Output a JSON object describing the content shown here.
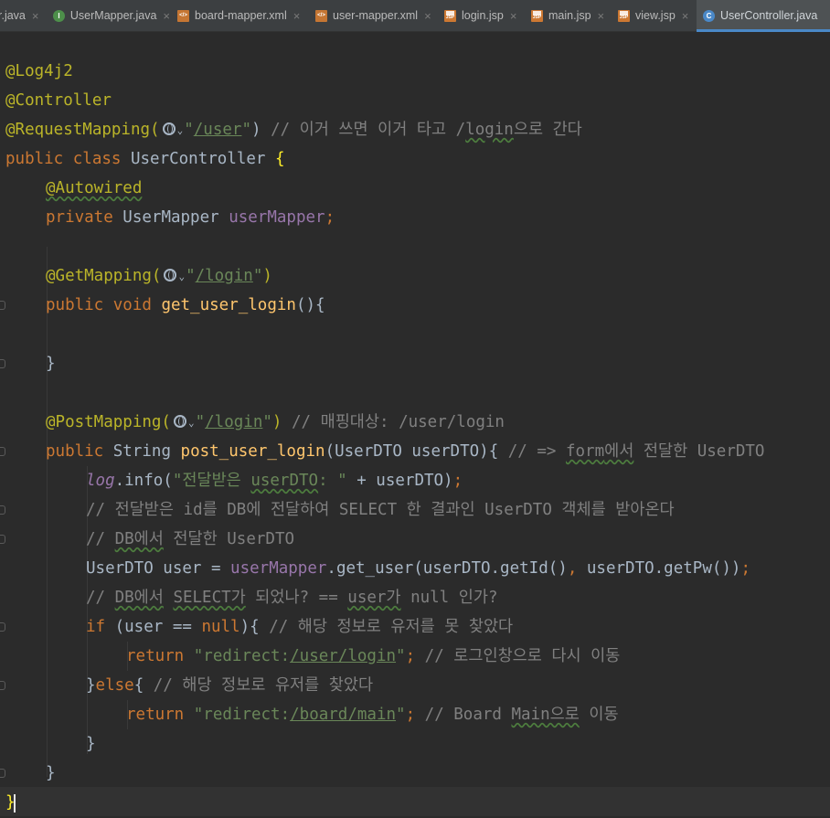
{
  "tabs": [
    {
      "label": "r.java",
      "icon": "java-file-icon",
      "active": false
    },
    {
      "label": "UserMapper.java",
      "icon": "interface-file-icon",
      "active": false
    },
    {
      "label": "board-mapper.xml",
      "icon": "xml-file-icon",
      "active": false
    },
    {
      "label": "user-mapper.xml",
      "icon": "xml-file-icon",
      "active": false
    },
    {
      "label": "login.jsp",
      "icon": "jsp-file-icon",
      "active": false
    },
    {
      "label": "main.jsp",
      "icon": "jsp-file-icon",
      "active": false
    },
    {
      "label": "view.jsp",
      "icon": "jsp-file-icon",
      "active": false
    },
    {
      "label": "UserController.java",
      "icon": "class-file-icon",
      "active": true
    }
  ],
  "tab_close_glyph": "×",
  "icon_glyphs": {
    "java": "I",
    "class": "C",
    "xml": "</>",
    "jsp": "JSP"
  },
  "code": {
    "l1": "@Log4j2",
    "l2": "@Controller",
    "l3": {
      "a": "@RequestMapping(",
      "b": "\"",
      "c": "/user",
      "d": "\"",
      "e": ") ",
      "f": "// 이거 쓰면 이거 타고 /",
      "g": "login",
      "h": "으로 간다"
    },
    "l4": {
      "a": "public class ",
      "b": "UserController ",
      "c": "{"
    },
    "l5": "@Autowired",
    "l6": {
      "a": "private ",
      "b": "UserMapper ",
      "c": "userMapper",
      "d": ";"
    },
    "l7": {
      "a": "@GetMapping(",
      "b": "\"",
      "c": "/login",
      "d": "\"",
      "e": ")"
    },
    "l8": {
      "a": "public void ",
      "b": "get_user_login",
      "c": "(){"
    },
    "l9": "}",
    "l10": {
      "a": "@PostMapping(",
      "b": "\"",
      "c": "/login",
      "d": "\"",
      "e": ") ",
      "f": "// 매핑대상: /user/login"
    },
    "l11": {
      "a": "public ",
      "b": "String ",
      "c": "post_user_login",
      "d": "(UserDTO userDTO){ ",
      "e": "// => ",
      "f": "form",
      "g": "에서",
      "h": " 전달한 UserDTO"
    },
    "l12": {
      "a": "log",
      "b": ".info(",
      "c": "\"전달받은 ",
      "d": "userDTO",
      "e": ": \"",
      "f": " + userDTO)",
      "g": ";"
    },
    "l13": "// 전달받은 id를 DB에 전달하여 SELECT 한 결과인 UserDTO 객체를 받아온다",
    "l14": {
      "a": "// ",
      "b": "DB에서",
      "c": " 전달한 UserDTO"
    },
    "l15": {
      "a": "UserDTO user = ",
      "b": "userMapper",
      "c": ".get_user(userDTO.getId()",
      "d": ", ",
      "e": "userDTO.getPw())",
      "f": ";"
    },
    "l16": {
      "a": "// ",
      "b": "DB에서",
      "c": " ",
      "d": "SELECT가",
      "e": " 되었나? == ",
      "f": "user가",
      "g": " null 인가?"
    },
    "l17": {
      "a": "if ",
      "b": "(user == ",
      "c": "null",
      "d": "){ ",
      "e": "// 해당 정보로 유저를 못 찾았다"
    },
    "l18": {
      "a": "return ",
      "b": "\"redirect:",
      "c": "/user/login",
      "d": "\"",
      "e": "; ",
      "f": "// 로그인창으로 다시 이동"
    },
    "l19": {
      "a": "}",
      "b": "else",
      "c": "{ ",
      "d": "// 해당 정보로 유저를 찾았다"
    },
    "l20": {
      "a": "return ",
      "b": "\"redirect:",
      "c": "/board/main",
      "d": "\"",
      "e": "; ",
      "f": "// Board ",
      "g": "Main으로",
      "h": " 이동"
    },
    "l21": "}",
    "l22": "}",
    "l23": "}"
  }
}
